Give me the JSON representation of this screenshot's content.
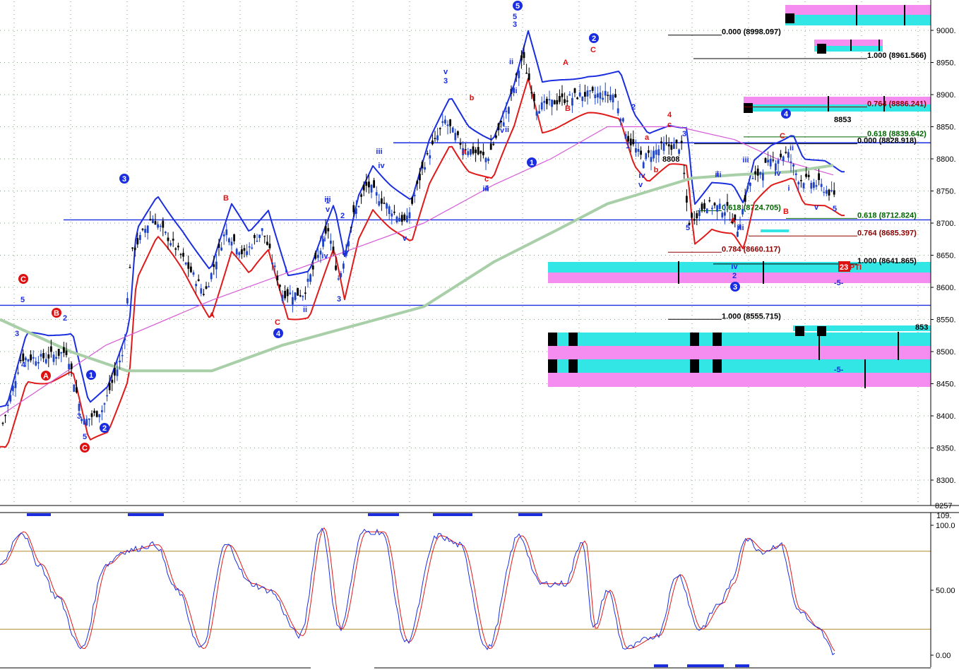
{
  "chart_data": {
    "type": "candlestick",
    "price_axis": {
      "ticks": [
        "9000.",
        "8950.",
        "8900.",
        "8850.",
        "8800.",
        "8750.",
        "8700.",
        "8650.",
        "8600.",
        "8550.",
        "8500.",
        "8450.",
        "8400.",
        "8350.",
        "8300."
      ],
      "tick_values": [
        9000,
        8950,
        8900,
        8850,
        8800,
        8750,
        8700,
        8650,
        8600,
        8550,
        8500,
        8450,
        8400,
        8350,
        8300
      ],
      "ylim": [
        8257,
        9050
      ],
      "bottom_label": "8257"
    },
    "stoch_axis": {
      "ticks": [
        "100.0",
        "50.00",
        "0.00"
      ],
      "tick_values": [
        100,
        50,
        0
      ],
      "top_label": "109.",
      "ylim": [
        -5,
        109
      ],
      "guides": [
        80,
        20
      ]
    },
    "horizontal_levels": [
      8825,
      8705,
      8572
    ],
    "fib_levels": [
      {
        "label": "0.000 (8998.097)",
        "value": 8998.097,
        "color": "#000000"
      },
      {
        "label": "1.000 (8961.566)",
        "value": 8961.566,
        "color": "#000000"
      },
      {
        "label": "0.764 (8886.241)",
        "value": 8886.241,
        "color": "#8b0000"
      },
      {
        "label": "0.618 (8839.642)",
        "value": 8839.642,
        "color": "#006400"
      },
      {
        "label": "0.000 (8828.918)",
        "value": 8828.918,
        "color": "#000000"
      },
      {
        "label": "0.618 (8712.824)",
        "value": 8712.824,
        "color": "#006400"
      },
      {
        "label": "0.764 (8685.397)",
        "value": 8685.397,
        "color": "#8b0000"
      },
      {
        "label": "1.000 (8555.715)",
        "value": 8555.715,
        "color": "#000000"
      },
      {
        "label": "0.784 (8660.117)",
        "value": 8660.117,
        "color": "#8b0000"
      },
      {
        "label": "0.618 (8724.705)",
        "value": 8724.705,
        "color": "#006400"
      },
      {
        "label": "1.000 (8641.865)",
        "value": 8641.865,
        "color": "#000000"
      }
    ],
    "misc_labels": [
      "8853",
      "8808",
      "853",
      "23",
      "PTI",
      "-5-",
      "-5-"
    ],
    "wave_labels": {
      "circled_blue": [
        "3",
        "1",
        "2",
        "4",
        "5",
        "1",
        "2",
        "4",
        "3"
      ],
      "circled_red": [
        "C",
        "B",
        "A",
        "C"
      ],
      "red": [
        "B",
        "A",
        "C",
        "a",
        "b",
        "c",
        "A",
        "B",
        "C",
        "a",
        "b",
        "c",
        "4",
        "A",
        "C",
        "B"
      ],
      "blue": [
        "5",
        "3",
        "4",
        "3",
        "2",
        "5",
        "i",
        "ii",
        "iii",
        "iv",
        "v",
        "1",
        "2",
        "3",
        "4",
        "5",
        "i",
        "ii",
        "iii",
        "iv",
        "v",
        "3",
        "v",
        "iii",
        "iv",
        "iii",
        "v",
        "3",
        "ii",
        "iii",
        "iv",
        "v",
        "1",
        "2",
        "3",
        "5",
        "iii",
        "iv",
        "i",
        "ii",
        "v",
        "5",
        "2",
        "iii",
        "i",
        "iv",
        "iii"
      ]
    }
  },
  "colors": {
    "up": "#1f44c8",
    "down": "#000000",
    "band_blue": "#1a2ee0",
    "band_red": "#e01a1a",
    "ma_pink": "#d65ad6",
    "ma_green": "#a9cfa9",
    "cyan": "#33e6e6",
    "magenta": "#f58cf0",
    "stoch_k": "#1a2ee0",
    "stoch_d": "#e01a1a",
    "guide": "#b08a2c"
  }
}
